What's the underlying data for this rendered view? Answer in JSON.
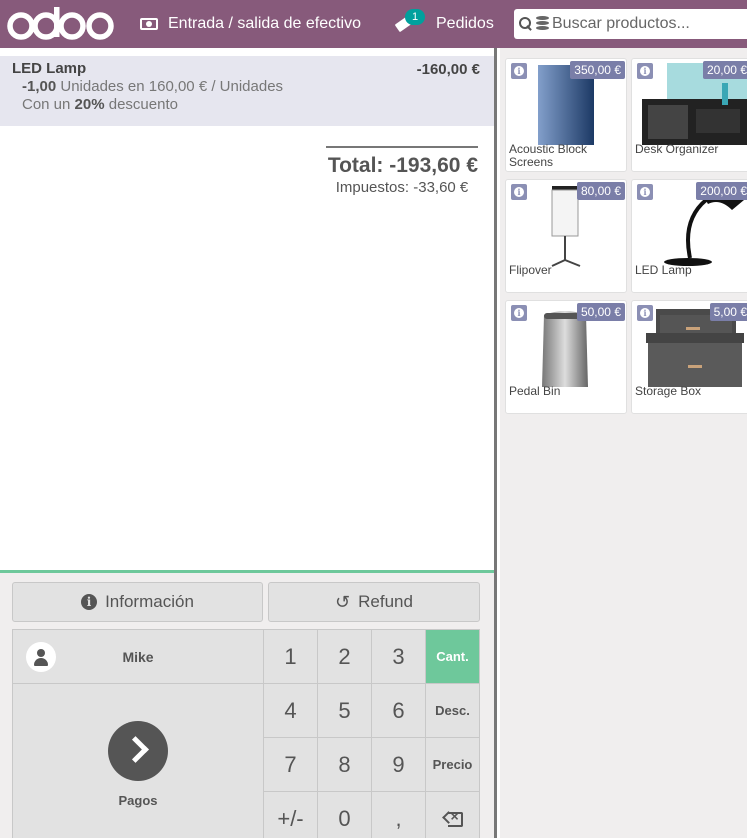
{
  "header": {
    "logo_text": "odoo",
    "cash_label": "Entrada / salida de efectivo",
    "orders_badge": "1",
    "orders_label": "Pedidos",
    "search_placeholder": "Buscar productos...",
    "brand_color": "#875a7b",
    "badge_color": "#00a09d"
  },
  "order": {
    "line": {
      "name": "LED Lamp",
      "price": "-160,00 €",
      "qty": "-1,00",
      "unit_info": "Unidades en 160,00 € / Unidades",
      "discount_prefix": "Con un",
      "discount_value": "20%",
      "discount_suffix": "descuento"
    },
    "total": "Total: -193,60 €",
    "taxes": "Impuestos: -33,60 €"
  },
  "controls": {
    "info_label": "Información",
    "refund_label": "Refund",
    "customer_name": "Mike",
    "payment_label": "Pagos",
    "keys": [
      "1",
      "2",
      "3",
      "4",
      "5",
      "6",
      "7",
      "8",
      "9",
      "+/-",
      "0",
      ","
    ],
    "modes": [
      "Cant.",
      "Desc.",
      "Precio"
    ],
    "active_mode": "Cant.",
    "accent_color": "#6ec89b"
  },
  "products": [
    {
      "name": "Acoustic Block Screens",
      "price": "350,00 €",
      "icon": "screen-panel"
    },
    {
      "name": "Desk Organizer",
      "price": "20,00 €",
      "icon": "desk-organizer"
    },
    {
      "name": "Flipover",
      "price": "80,00 €",
      "icon": "flipchart"
    },
    {
      "name": "LED Lamp",
      "price": "200,00 €",
      "icon": "desk-lamp"
    },
    {
      "name": "Pedal Bin",
      "price": "50,00 €",
      "icon": "pedal-bin"
    },
    {
      "name": "Storage Box",
      "price": "5,00 €",
      "icon": "storage-box"
    }
  ]
}
